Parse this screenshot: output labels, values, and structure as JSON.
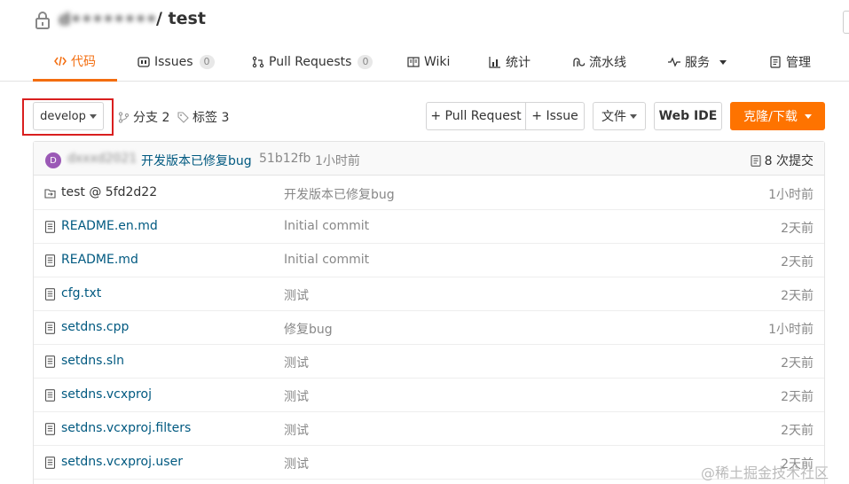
{
  "header": {
    "owner": "d••••••••",
    "repo_path": "/ test"
  },
  "tabs": [
    {
      "label": "代码",
      "icon": "code-icon"
    },
    {
      "label": "Issues",
      "count": "0",
      "icon": "issues-icon"
    },
    {
      "label": "Pull Requests",
      "count": "0",
      "icon": "pull-request-icon"
    },
    {
      "label": "Wiki",
      "icon": "wiki-icon"
    },
    {
      "label": "统计",
      "icon": "chart-icon"
    },
    {
      "label": "流水线",
      "icon": "pipeline-icon"
    },
    {
      "label": "服务",
      "icon": "pulse-icon"
    },
    {
      "label": "管理",
      "icon": "manage-icon"
    }
  ],
  "toolbar": {
    "branch": "develop",
    "branches": "分支 2",
    "tags": "标签 3",
    "pull_request": "+ Pull Request",
    "issue": "+ Issue",
    "file": "文件",
    "web_ide": "Web IDE",
    "clone": "克隆/下载"
  },
  "commit": {
    "avatar_letter": "D",
    "author": "dxxxd2021",
    "message": "开发版本已修复bug",
    "sha": "51b12fb",
    "time": "1小时前",
    "count_label": "8 次提交"
  },
  "files": [
    {
      "name": "test @ 5fd2d22",
      "type": "submodule",
      "message": "开发版本已修复bug",
      "time": "1小时前"
    },
    {
      "name": "README.en.md",
      "type": "file",
      "message": "Initial commit",
      "time": "2天前"
    },
    {
      "name": "README.md",
      "type": "file",
      "message": "Initial commit",
      "time": "2天前"
    },
    {
      "name": "cfg.txt",
      "type": "file",
      "message": "测试",
      "time": "2天前"
    },
    {
      "name": "setdns.cpp",
      "type": "file",
      "message": "修复bug",
      "time": "1小时前"
    },
    {
      "name": "setdns.sln",
      "type": "file",
      "message": "测试",
      "time": "2天前"
    },
    {
      "name": "setdns.vcxproj",
      "type": "file",
      "message": "测试",
      "time": "2天前"
    },
    {
      "name": "setdns.vcxproj.filters",
      "type": "file",
      "message": "测试",
      "time": "2天前"
    },
    {
      "name": "setdns.vcxproj.user",
      "type": "file",
      "message": "测试",
      "time": "2天前"
    }
  ],
  "watermark": "@稀土掘金技术社区",
  "colors": {
    "accent": "#f36d0f",
    "clone_button": "#fe7300",
    "link": "#005980",
    "highlight_box": "#d91f1f"
  }
}
